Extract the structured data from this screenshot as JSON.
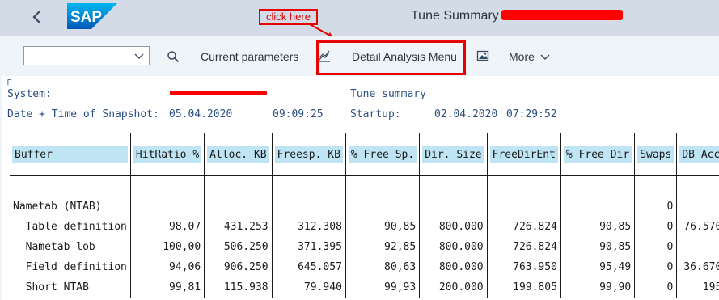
{
  "shell": {
    "title": "Tune Summary",
    "annotation": "click here"
  },
  "toolbar": {
    "command_value": "",
    "current_parameters": "Current parameters",
    "detail_analysis": "Detail Analysis Menu",
    "more": "More"
  },
  "info": {
    "system_label": "System:",
    "tune_summary": "Tune summary",
    "snapshot_label": "Date + Time of Snapshot:",
    "snapshot_date": "05.04.2020",
    "snapshot_time": "09:09:25",
    "startup_label": "Startup:",
    "startup_date": "02.04.2020",
    "startup_time": "07:29:52"
  },
  "table": {
    "headers": [
      "Buffer",
      "HitRatio %",
      "Alloc. KB",
      "Freesp. KB",
      "% Free Sp.",
      "Dir. Size",
      "FreeDirEnt",
      "% Free Dir",
      "Swaps",
      "DB Acc"
    ],
    "rows": [
      [
        "",
        "",
        "",
        "",
        "",
        "",
        "",
        "",
        "",
        ""
      ],
      [
        "Nametab (NTAB)",
        "",
        "",
        "",
        "",
        "",
        "",
        "",
        "0",
        ""
      ],
      [
        "  Table definition",
        "98,07",
        "431.253",
        "312.308",
        "90,85",
        "800.000",
        "726.824",
        "90,85",
        "0",
        "76.570"
      ],
      [
        "  Nametab lob",
        "100,00",
        "506.250",
        "371.395",
        "92,85",
        "800.000",
        "726.824",
        "90,85",
        "0",
        ""
      ],
      [
        "  Field definition",
        "94,06",
        "906.250",
        "645.057",
        "80,63",
        "800.000",
        "763.950",
        "95,49",
        "0",
        "36.670"
      ],
      [
        "  Short NTAB",
        "99,81",
        "115.938",
        "79.940",
        "99,93",
        "200.000",
        "199.805",
        "99,90",
        "0",
        "195"
      ]
    ]
  }
}
